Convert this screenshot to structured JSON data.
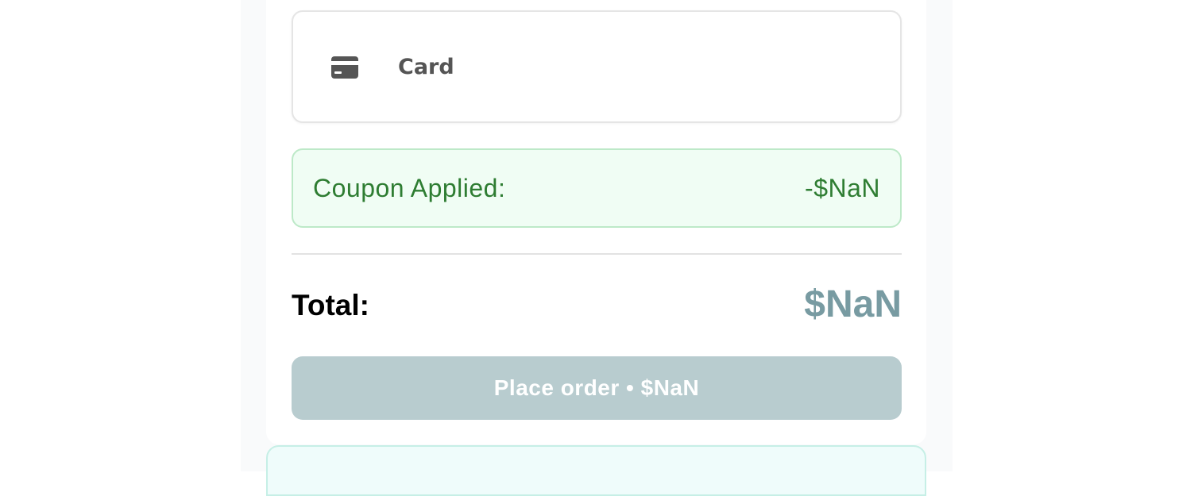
{
  "payment": {
    "method_label": "Card",
    "method_icon": "credit-card-icon"
  },
  "coupon": {
    "label": "Coupon Applied:",
    "amount": "-$NaN"
  },
  "total": {
    "label": "Total:",
    "amount": "$NaN"
  },
  "actions": {
    "place_order_label": "Place order • $NaN"
  },
  "colors": {
    "coupon_text": "#2e7d32",
    "coupon_bg": "#f0fdf4",
    "total_amount": "#789ba2",
    "button_disabled_bg": "#b8cccf"
  }
}
